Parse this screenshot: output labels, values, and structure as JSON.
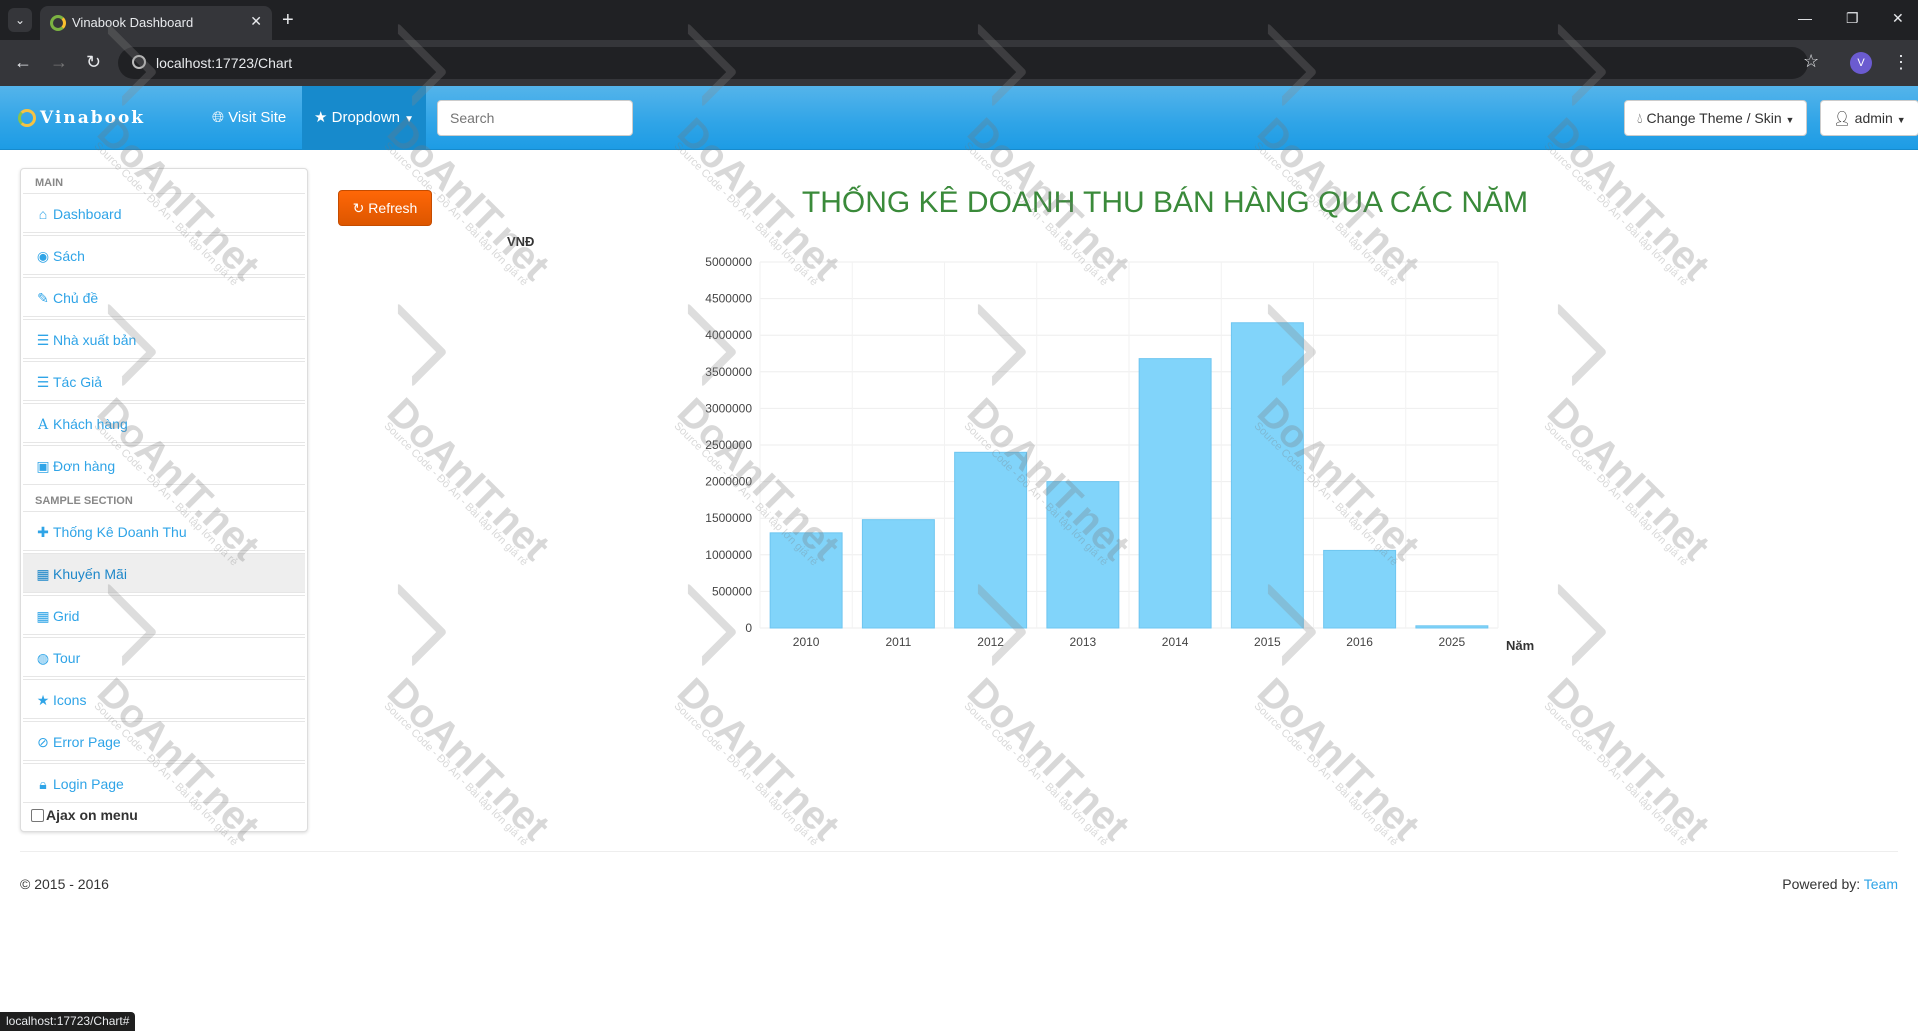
{
  "browser": {
    "tab_title": "Vinabook Dashboard",
    "url": "localhost:17723/Chart",
    "status_url": "localhost:17723/Chart#",
    "profile_initial": "V"
  },
  "navbar": {
    "brand": "Vinabook",
    "visit_site": "Visit Site",
    "dropdown": "Dropdown",
    "search_placeholder": "Search",
    "theme_button": "Change Theme / Skin",
    "user_button": "admin"
  },
  "sidebar": {
    "header_main": "MAIN",
    "items_main": [
      {
        "label": "Dashboard",
        "icon": "home-icon"
      },
      {
        "label": "Sách",
        "icon": "eye-icon"
      },
      {
        "label": "Chủ đề",
        "icon": "edit-icon"
      },
      {
        "label": "Nhà xuất bản",
        "icon": "list-icon"
      },
      {
        "label": "Tác Giả",
        "icon": "list-icon"
      },
      {
        "label": "Khách hàng",
        "icon": "font-icon"
      },
      {
        "label": "Đơn hàng",
        "icon": "picture-icon"
      }
    ],
    "header_sample": "SAMPLE SECTION",
    "items_sample": [
      {
        "label": "Thống Kê Doanh Thu",
        "icon": "plus-icon"
      },
      {
        "label": "Khuyến Mãi",
        "icon": "calendar-icon"
      },
      {
        "label": "Grid",
        "icon": "grid-icon"
      },
      {
        "label": "Tour",
        "icon": "globe-icon"
      },
      {
        "label": "Icons",
        "icon": "star-icon"
      },
      {
        "label": "Error Page",
        "icon": "ban-icon"
      },
      {
        "label": "Login Page",
        "icon": "lock-icon"
      }
    ],
    "ajax_label": "Ajax on menu"
  },
  "content": {
    "refresh_label": "Refresh"
  },
  "chart_data": {
    "type": "bar",
    "title": "THỐNG KÊ DOANH THU BÁN HÀNG QUA CÁC NĂM",
    "ylabel": "VNĐ",
    "xlabel": "Năm",
    "categories": [
      "2010",
      "2011",
      "2012",
      "2013",
      "2014",
      "2015",
      "2016",
      "2025"
    ],
    "values": [
      1300000,
      1480000,
      2400000,
      2000000,
      3680000,
      4170000,
      1060000,
      30000
    ],
    "ylim": [
      0,
      5000000
    ],
    "yticks": [
      0,
      500000,
      1000000,
      1500000,
      2000000,
      2500000,
      3000000,
      3500000,
      4000000,
      4500000,
      5000000
    ],
    "bar_color": "#81d4fa",
    "grid": true
  },
  "footer": {
    "copyright": "© 2015 - 2016",
    "powered_by": "Powered by:",
    "team": "Team"
  },
  "watermark": {
    "text": "DoAnIT.net",
    "subtext": "Source Code - Đồ Án - Bài tập lớn giá rẻ"
  }
}
